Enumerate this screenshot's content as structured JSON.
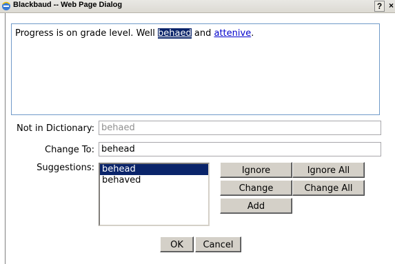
{
  "window": {
    "title": "Blackbaud -- Web Page Dialog",
    "help_label": "?",
    "close_label": "×"
  },
  "text_pane": {
    "prefix": "Progress is on grade level. Well ",
    "highlighted_word": "behaed",
    "middle": " and ",
    "error_word": "attenive",
    "suffix": "."
  },
  "form": {
    "not_in_dictionary_label": "Not in Dictionary:",
    "not_in_dictionary_value": "behaed",
    "change_to_label": "Change To:",
    "change_to_value": "behead",
    "suggestions_label": "Suggestions:",
    "suggestions": [
      "behead",
      "behaved"
    ]
  },
  "buttons": {
    "ignore": "Ignore",
    "ignore_all": "Ignore All",
    "change": "Change",
    "change_all": "Change All",
    "add": "Add",
    "ok": "OK",
    "cancel": "Cancel"
  },
  "colors": {
    "selection": "#0a246a",
    "pane_border": "#6f99c8"
  }
}
